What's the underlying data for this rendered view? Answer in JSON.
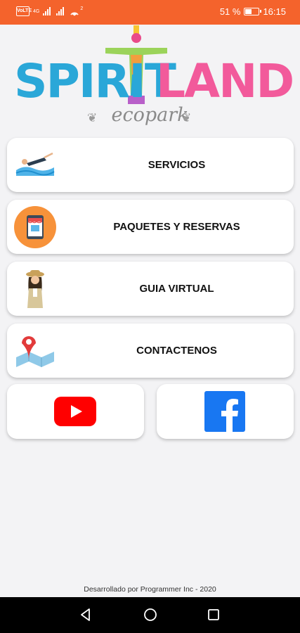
{
  "status_bar": {
    "carrier_badge": "VoLTE",
    "network_small": "4G",
    "hotspot_small": "2",
    "battery_percent": "51 %",
    "battery_level": 0.51,
    "time": "16:15"
  },
  "logo": {
    "part1": "SPIRIT",
    "part2": "LAND",
    "tagline": "ecopark",
    "leaf_glyph": "❦"
  },
  "menu": [
    {
      "label": "SERVICIOS",
      "icon": "swimmer-icon"
    },
    {
      "label": "PAQUETES Y RESERVAS",
      "icon": "store-icon"
    },
    {
      "label": "GUIA VIRTUAL",
      "icon": "guide-icon"
    },
    {
      "label": "CONTACTENOS",
      "icon": "map-pin-icon"
    }
  ],
  "social": {
    "youtube_icon": "youtube-icon",
    "facebook_icon": "facebook-icon"
  },
  "footer": {
    "text": "Desarrollado por Programmer Inc - 2020"
  },
  "colors": {
    "status_bar": "#f4632c",
    "youtube_red": "#ff0000",
    "facebook_blue": "#1877f2",
    "background": "#f3f3f5"
  }
}
